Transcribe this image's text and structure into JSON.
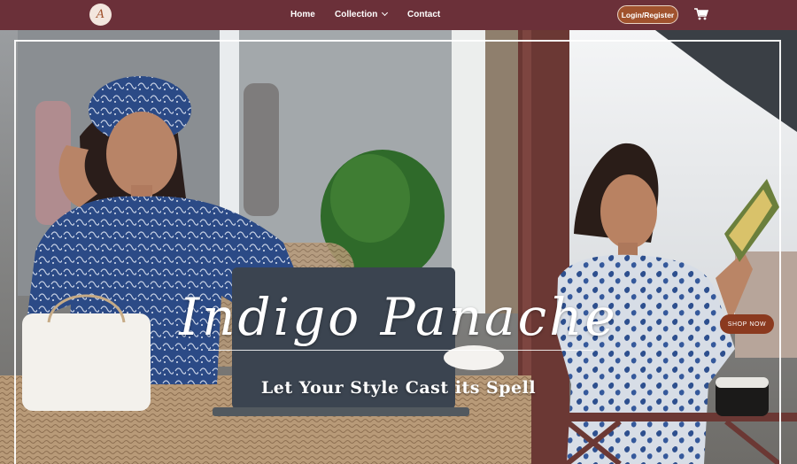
{
  "brand": {
    "logo_letter": "A"
  },
  "nav": {
    "home": "Home",
    "collection": "Collection",
    "contact": "Contact",
    "login": "Login/Register",
    "cart_icon": "cart-icon"
  },
  "hero": {
    "title": "Indigo Panache",
    "subtitle": "Let Your Style Cast its Spell",
    "cta": "SHOP NOW"
  },
  "colors": {
    "nav_bg": "#6b3039",
    "accent": "#a0522d",
    "indigo": "#2c4a86"
  }
}
